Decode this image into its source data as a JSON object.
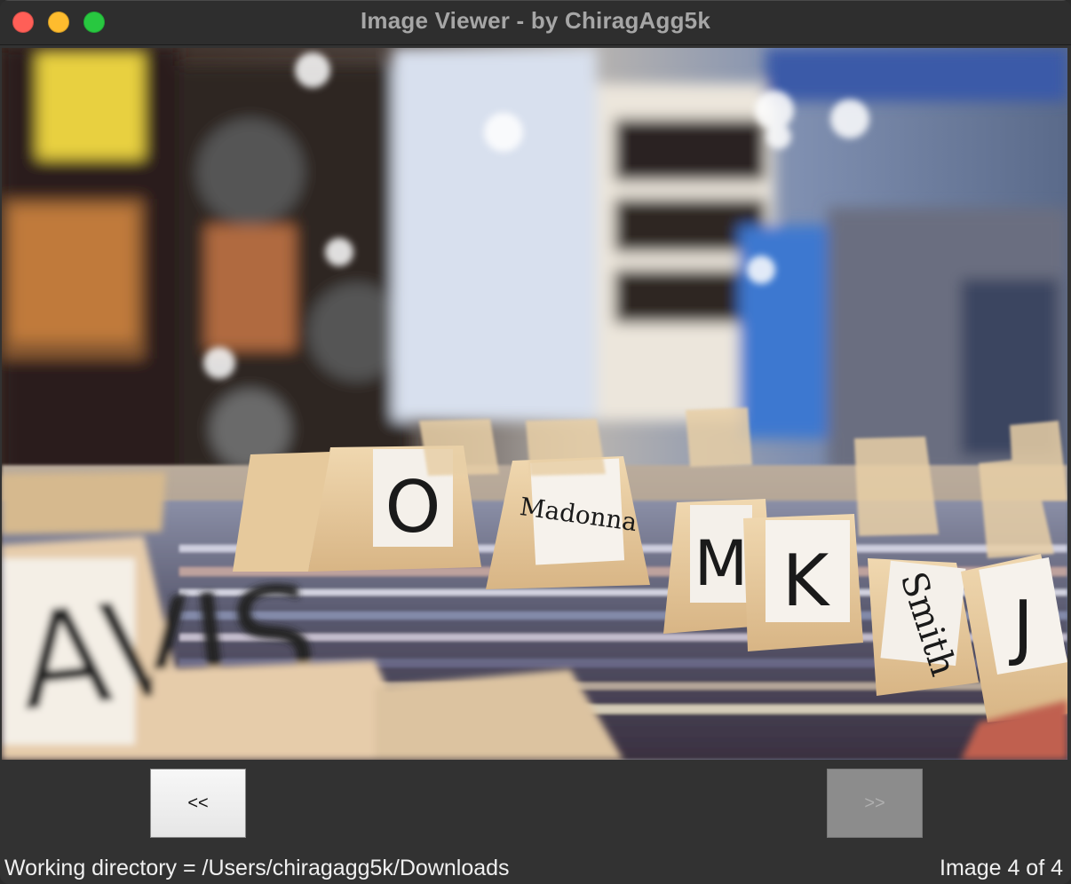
{
  "window": {
    "title": "Image Viewer - by ChiragAgg5k"
  },
  "image": {
    "subject": "record store crates with divider cards",
    "divider_labels": [
      "O",
      "Madonna",
      "M",
      "K",
      "Smith",
      "J",
      "AVIS"
    ]
  },
  "controls": {
    "prev_label": "<<",
    "next_label": ">>",
    "next_enabled": false
  },
  "status": {
    "directory": "Working directory = /Users/chiragagg5k/Downloads",
    "position": "Image 4 of 4"
  },
  "colors": {
    "close": "#ff5f57",
    "minimize": "#febc2e",
    "maximize": "#28c840",
    "background": "#323232"
  }
}
